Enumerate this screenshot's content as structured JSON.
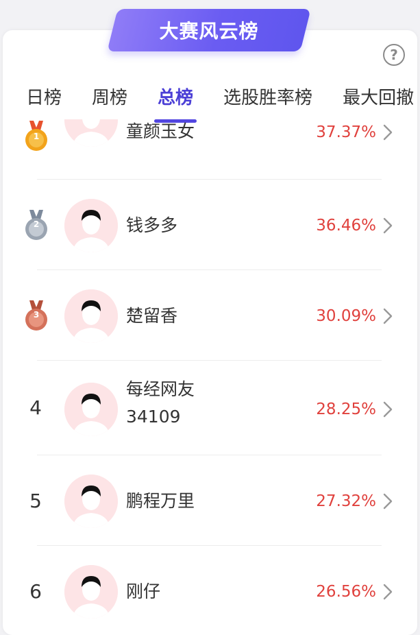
{
  "banner": {
    "title": "大赛风云榜"
  },
  "tabs": [
    {
      "label": "日榜"
    },
    {
      "label": "周榜"
    },
    {
      "label": "总榜"
    },
    {
      "label": "选股胜率榜"
    },
    {
      "label": "最大回撤"
    }
  ],
  "active_tab": "总榜",
  "colors": {
    "accent": "#5246e0",
    "percent": "#e0413d",
    "gold": "#f2a31b",
    "silver": "#9aa4b1",
    "bronze": "#d4715a"
  },
  "rows": [
    {
      "rank": "1",
      "name": "童颜玉女",
      "value": "37.37%"
    },
    {
      "rank": "2",
      "name": "钱多多",
      "value": "36.46%"
    },
    {
      "rank": "3",
      "name": "楚留香",
      "value": "30.09%"
    },
    {
      "rank": "4",
      "name": "每经网友",
      "name2": "34109",
      "value": "28.25%"
    },
    {
      "rank": "5",
      "name": "鹏程万里",
      "value": "27.32%"
    },
    {
      "rank": "6",
      "name": "刚仔",
      "value": "26.56%"
    }
  ]
}
